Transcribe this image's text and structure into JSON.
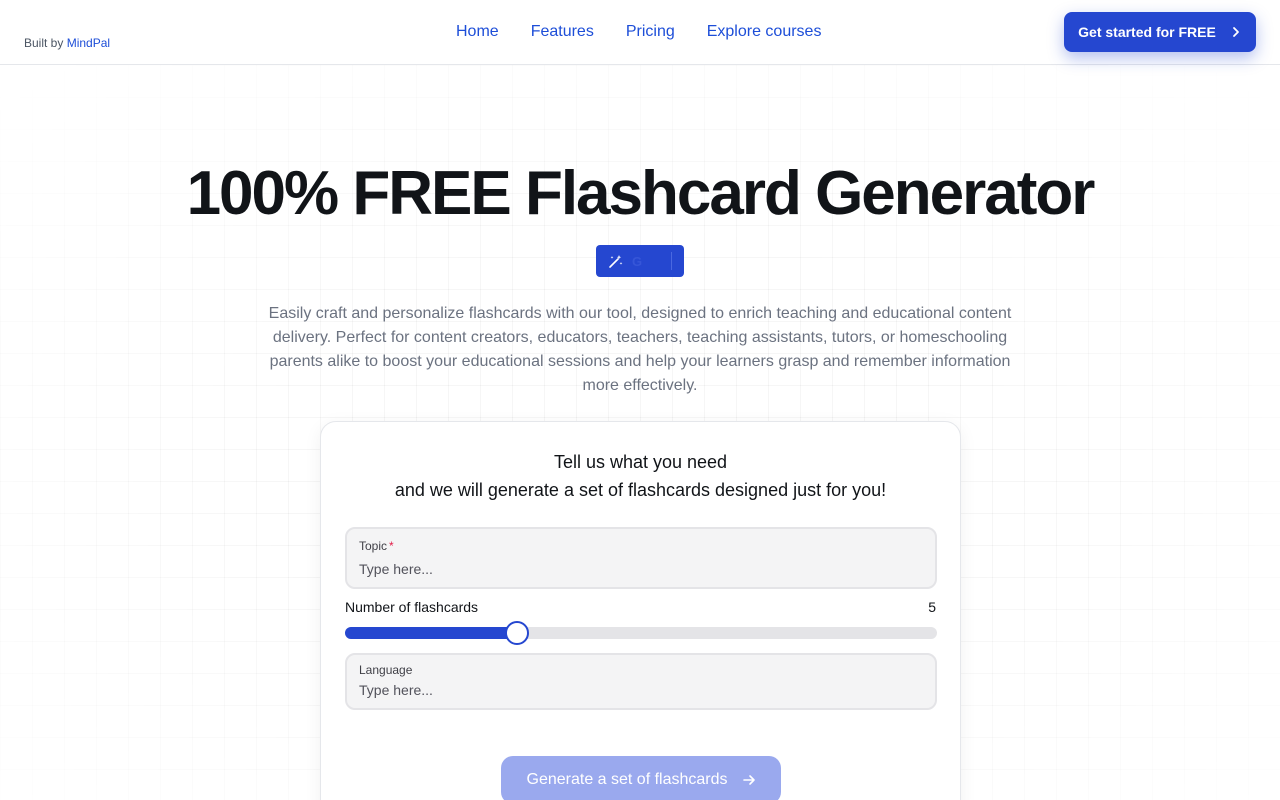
{
  "header": {
    "brand_prefix": "Built by",
    "brand_name": "MindPal",
    "nav": [
      "Home",
      "Features",
      "Pricing",
      "Explore courses"
    ],
    "cta_label": "Get started for FREE"
  },
  "hero": {
    "title": "100% FREE Flashcard Generator",
    "badge_text": "G",
    "description": "Easily craft and personalize flashcards with our tool, designed to enrich teaching and educational content delivery. Perfect for content creators, educators, teachers, teaching assistants, tutors, or homeschooling parents alike to boost your educational sessions and help your learners grasp and remember information more effectively."
  },
  "form": {
    "heading_line1": "Tell us what you need",
    "heading_line2": "and we will generate a set of flashcards designed just for you!",
    "topic": {
      "label": "Topic",
      "required_mark": "*",
      "placeholder": "Type here...",
      "value": ""
    },
    "count": {
      "label": "Number of flashcards",
      "value": "5",
      "fill_percent": 29
    },
    "language": {
      "label": "Language",
      "placeholder": "Type here...",
      "value": ""
    },
    "submit_label": "Generate a set of flashcards"
  },
  "colors": {
    "accent": "#2547d0",
    "accent_disabled": "#9aa9ee",
    "link": "#1d4ed8",
    "required": "#e11d48"
  },
  "icons": {
    "cta": "chevron-right-icon",
    "badge": "magic-wand-icon",
    "submit": "arrow-right-icon"
  }
}
